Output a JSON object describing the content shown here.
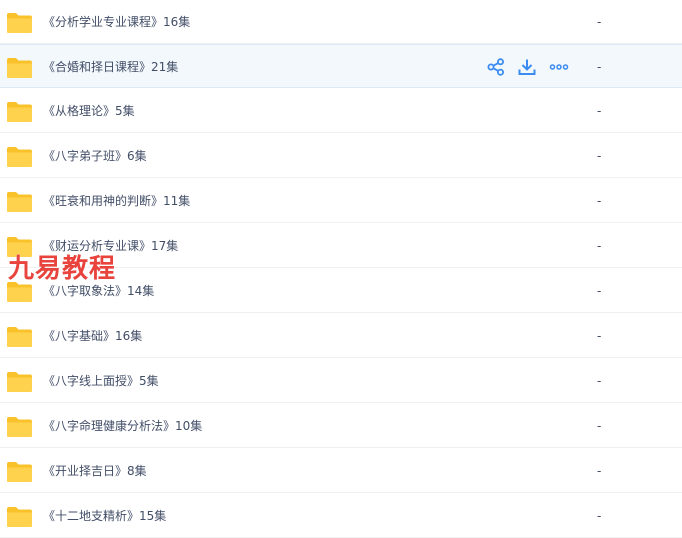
{
  "files": [
    {
      "name": "《分析学业专业课程》16集",
      "size": "-"
    },
    {
      "name": "《合婚和择日课程》21集",
      "size": "-",
      "hovered": true
    },
    {
      "name": "《从格理论》5集",
      "size": "-"
    },
    {
      "name": "《八字弟子班》6集",
      "size": "-"
    },
    {
      "name": "《旺衰和用神的判断》11集",
      "size": "-"
    },
    {
      "name": "《财运分析专业课》17集",
      "size": "-"
    },
    {
      "name": "《八字取象法》14集",
      "size": "-"
    },
    {
      "name": "《八字基础》16集",
      "size": "-"
    },
    {
      "name": "《八字线上面授》5集",
      "size": "-"
    },
    {
      "name": "《八字命理健康分析法》10集",
      "size": "-"
    },
    {
      "name": "《开业择吉日》8集",
      "size": "-"
    },
    {
      "name": "《十二地支精析》15集",
      "size": "-"
    }
  ],
  "row_actions": [
    "share-icon",
    "download-icon",
    "more-icon"
  ],
  "watermark": "九易教程",
  "colors": {
    "folder": "#ffd24d",
    "folder_tab": "#f9c22b",
    "action_icon": "#3b8cf0",
    "hover_bg": "#f3f8fd",
    "text": "#424e67",
    "watermark": "#e8443d"
  }
}
